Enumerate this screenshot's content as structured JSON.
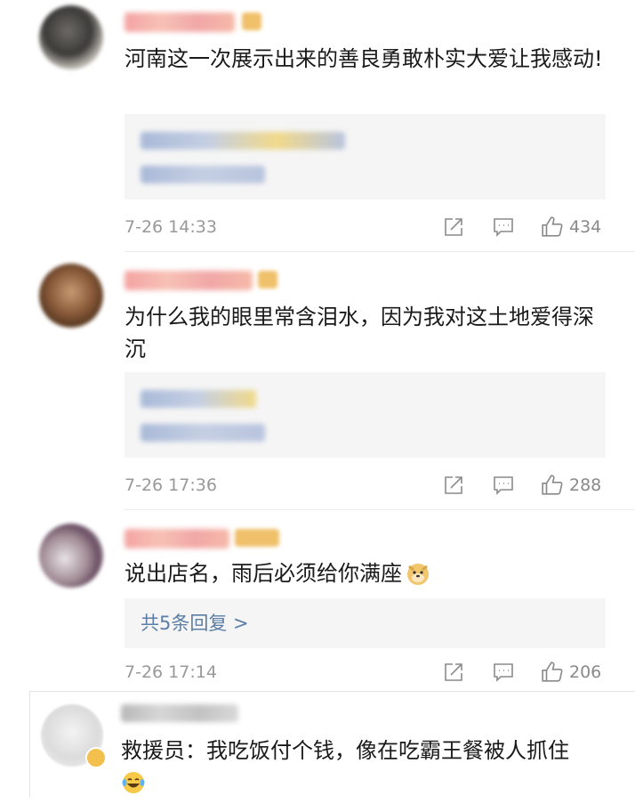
{
  "comments": [
    {
      "text": "河南这一次展示出来的善良勇敢朴实大爱让我感动!",
      "date": "7-26 14:33",
      "likes": "434"
    },
    {
      "text": "为什么我的眼里常含泪水，因为我对这土地爱得深沉",
      "date": "7-26 17:36",
      "likes": "288"
    },
    {
      "text": "说出店名，雨后必须给你满座",
      "date": "7-26 17:14",
      "likes": "206",
      "replies_label": "共5条回复 >"
    }
  ],
  "last_comment": {
    "text": "救援员：我吃饭付个钱，像在吃霸王餐被人抓住"
  },
  "icons": {
    "share": "share-icon",
    "comment": "comment-icon",
    "like": "thumbs-up-icon",
    "emoji_doge": "doge-emoji-icon",
    "emoji_laugh": "laughing-tears-emoji-icon"
  },
  "colors": {
    "link": "#5c7ea6",
    "meta": "#999999",
    "reply_bg": "#f5f5f5"
  }
}
